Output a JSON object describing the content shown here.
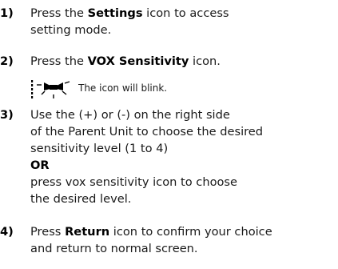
{
  "steps": [
    {
      "number": "1)",
      "lines": [
        [
          "Press the ",
          "Settings",
          " icon to access"
        ],
        [
          "setting mode."
        ]
      ]
    },
    {
      "number": "2)",
      "lines": [
        [
          "Press the ",
          "VOX Sensitivity",
          " icon."
        ]
      ],
      "note": "The icon will blink.",
      "note_icon": "vox-sensitivity-blink-icon"
    },
    {
      "number": "3)",
      "lines": [
        [
          "Use the (+) or (-) on the right side"
        ],
        [
          "of the Parent Unit to choose the desired"
        ],
        [
          "sensitivity level (1 to 4)"
        ]
      ],
      "or_label": "OR",
      "after_or": [
        "press vox sensitivity icon to choose",
        "the desired level."
      ]
    },
    {
      "number": "4)",
      "lines": [
        [
          "Press ",
          "Return",
          " icon to confirm your choice"
        ],
        [
          "and return to normal screen."
        ]
      ]
    }
  ]
}
